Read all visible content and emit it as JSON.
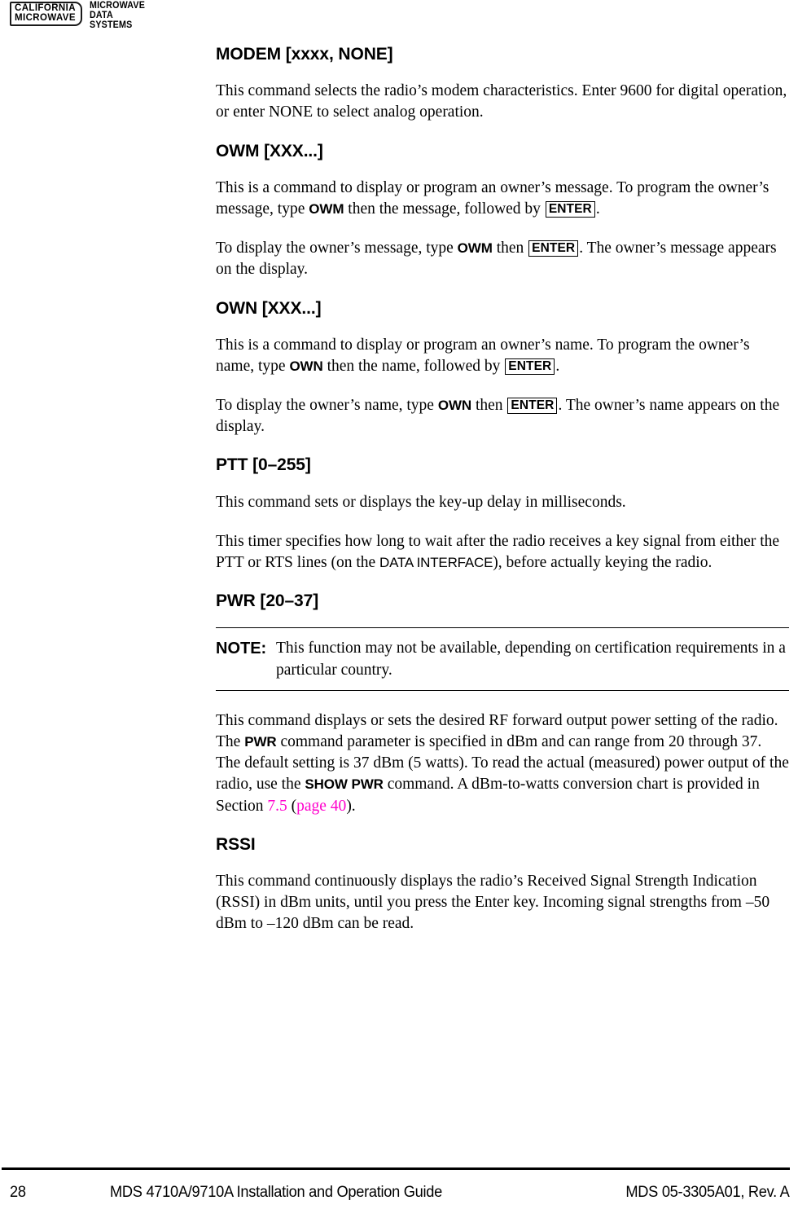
{
  "header": {
    "logo_box_lines": [
      "CALIFORNIA",
      "MICROWAVE"
    ],
    "logo_words": [
      "MICROWAVE",
      "DATA",
      "SYSTEMS"
    ]
  },
  "colors": {
    "xref": "#ff00cc",
    "text": "#000000",
    "background": "#ffffff"
  },
  "sections": [
    {
      "heading": "MODEM [xxxx, NONE]",
      "paragraphs": [
        "This command selects the radio’s modem characteristics. Enter 9600 for digital operation, or enter NONE to select analog operation."
      ]
    },
    {
      "heading": "OWM [XXX...]",
      "paragraphs": [
        "This is a command to display or program an owner’s message. To program the owner’s message, type OWM then the message, followed by ENTER.",
        "To display the owner’s message, type OWM then ENTER. The owner’s message appears on the display."
      ]
    },
    {
      "heading": "OWN [XXX...]",
      "paragraphs": [
        "This is a command to display or program an owner’s name. To program the owner’s name, type OWN then the name, followed by ENTER.",
        "To display the owner’s name, type OWN then ENTER. The owner’s name appears on the display."
      ]
    },
    {
      "heading": "PTT [0–255]",
      "paragraphs": [
        "This command sets or displays the key-up delay in milliseconds.",
        "This timer specifies how long to wait after the radio receives a key signal from either the PTT or RTS lines (on the DATA INTERFACE), before actually keying the radio."
      ]
    },
    {
      "heading": "PWR [20–37]",
      "paragraphs": [
        "This command displays or sets the desired RF forward output power setting of the radio. The PWR command parameter is specified in dBm and can range from 20 through 37. The default setting is 37 dBm (5 watts). To read the actual (measured) power output of the radio, use the SHOW PWR command. A dBm-to-watts conversion chart is provided in Section 7.5 (page 40)."
      ]
    },
    {
      "heading": "RSSI",
      "paragraphs": [
        "This command continuously displays the radio’s Received Signal Strength Indication (RSSI) in dBm units, until you press the Enter key. Incoming signal strengths from –50 dBm to –120 dBm can be read."
      ]
    }
  ],
  "fragments": {
    "modem_p1_a": "This command selects the radio’s modem characteristics. Enter 9600 for digital operation, or enter NONE to select analog operation.",
    "owm_p1_a": "This is a command to display or program an owner’s message. To program the owner’s message, type ",
    "owm_p1_cmd": "OWM",
    "owm_p1_b": " then the message, followed by ",
    "owm_p1_key": "ENTER",
    "owm_p1_c": ".",
    "owm_p2_a": "To display the owner’s message, type ",
    "owm_p2_cmd": "OWM",
    "owm_p2_b": " then ",
    "owm_p2_key": "ENTER",
    "owm_p2_c": ". The owner’s message appears on the display.",
    "own_p1_a": "This is a command to display or program an owner’s name. To program the owner’s name, type ",
    "own_p1_cmd": "OWN",
    "own_p1_b": " then the name, followed by ",
    "own_p1_key": "ENTER",
    "own_p1_c": ".",
    "own_p2_a": "To display the owner’s name, type ",
    "own_p2_cmd": "OWN",
    "own_p2_b": " then ",
    "own_p2_key": "ENTER",
    "own_p2_c": ". The owner’s name appears on the display.",
    "ptt_p1": "This command sets or displays the key-up delay in milliseconds.",
    "ptt_p2_a": "This timer specifies how long to wait after the radio receives a key signal from either the PTT or RTS lines (on the ",
    "ptt_p2_iface": "DATA INTERFACE",
    "ptt_p2_b": "), before actually keying the radio.",
    "pwr_p1_a": "This command displays or sets the desired RF forward output power setting of the radio. The ",
    "pwr_p1_cmd1": "PWR",
    "pwr_p1_b": " command parameter is specified in dBm and can range from 20 through 37. The default setting is 37 dBm (5 watts). To read the actual (measured) power output of the radio, use the ",
    "pwr_p1_cmd2": "SHOW PWR",
    "pwr_p1_c": " command. A dBm-to-watts conversion chart is provided in Section ",
    "pwr_p1_xref_section": "7.5",
    "pwr_p1_d": " (",
    "pwr_p1_xref_page": "page 40",
    "pwr_p1_e": ").",
    "rssi_p1": "This command continuously displays the radio’s Received Signal Strength Indication (RSSI) in dBm units, until you press the Enter key. Incoming signal strengths from –50 dBm to –120 dBm can be read."
  },
  "note": {
    "label": "NOTE:",
    "text": "This function may not be available, depending on certification requirements in a particular country."
  },
  "footer": {
    "page_number": "28",
    "title": "MDS 4710A/9710A Installation and Operation Guide",
    "document_number": "MDS 05-3305A01, Rev. A"
  }
}
